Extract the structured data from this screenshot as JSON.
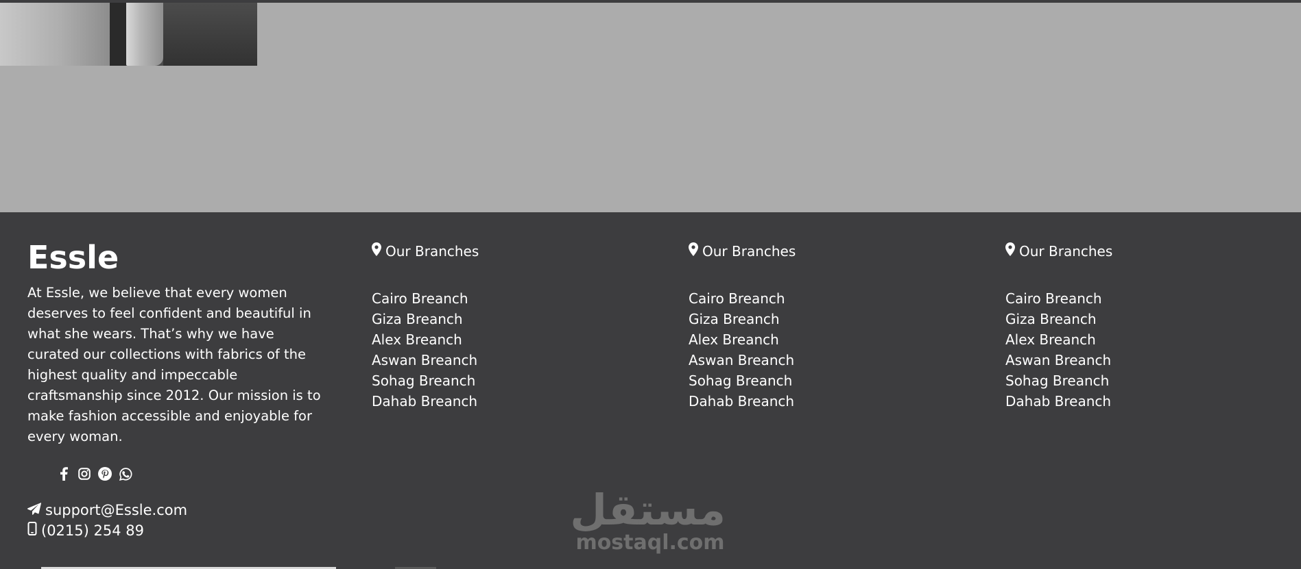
{
  "footer": {
    "brand": {
      "title": "Essle",
      "description": "At Essle, we believe that every women deserves to feel confident and beautiful in what she wears. That’s why we have curated our collections with fabrics of the highest quality and impeccable craftsmanship since 2012. Our mission is to make fashion accessible and enjoyable for every woman."
    },
    "socials": [
      {
        "icon": "facebook-icon"
      },
      {
        "icon": "instagram-icon"
      },
      {
        "icon": "pinterest-icon"
      },
      {
        "icon": "whatsapp-icon"
      }
    ],
    "contact": {
      "email": "support@Essle.com",
      "phone": "(0215) 254 89"
    },
    "branch_columns": [
      {
        "header": "Our Branches",
        "items": [
          "Cairo Breanch",
          "Giza Breanch",
          "Alex Breanch",
          "Aswan Breanch",
          "Sohag Breanch",
          "Dahab Breanch"
        ]
      },
      {
        "header": "Our Branches",
        "items": [
          "Cairo Breanch",
          "Giza Breanch",
          "Alex Breanch",
          "Aswan Breanch",
          "Sohag Breanch",
          "Dahab Breanch"
        ]
      },
      {
        "header": "Our Branches",
        "items": [
          "Cairo Breanch",
          "Giza Breanch",
          "Alex Breanch",
          "Aswan Breanch",
          "Sohag Breanch",
          "Dahab Breanch"
        ]
      }
    ]
  },
  "watermark": {
    "arabic": "مستقل",
    "latin": "mostaql.com"
  },
  "colors": {
    "page_background": "#acacac",
    "footer_background": "#3d3d3f",
    "text": "#ffffff",
    "watermark": "#6f6f6f"
  }
}
